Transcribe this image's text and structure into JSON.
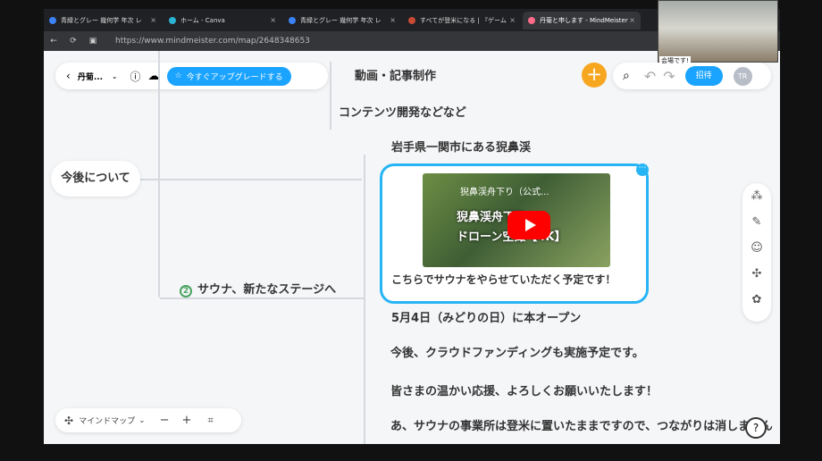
{
  "tabs": [
    {
      "label": "青緑とグレー 幾何学 年次 レ",
      "active": false
    },
    {
      "label": "ホーム - Canva",
      "active": false
    },
    {
      "label": "青緑とグレー 幾何学 年次 レ",
      "active": false
    },
    {
      "label": "すべてが登米になる | 『ゲーム",
      "active": false
    },
    {
      "label": "丹菊と申します - MindMeister",
      "active": true
    }
  ],
  "url": "https://www.mindmeister.com/map/2648348653",
  "toolbar": {
    "title": "丹菊...",
    "upgrade": "今すぐアップグレードする"
  },
  "top_actions": {
    "invite": "招待",
    "avatar": "TR"
  },
  "nodes": {
    "today": "今後について",
    "video_editing": "動画・記事制作",
    "content": "コンテンツ開発などなど",
    "iwate": "岩手県一関市にある猊鼻渓",
    "sauna": "サウナ、新たなステージへ",
    "sauna_number": "2",
    "video_caption": "こちらでサウナをやらせていただく予定です！",
    "opening": "5月4日（みどりの日）に本オープン",
    "crowdfunding": "今後、クラウドファンディングも実施予定です。",
    "support": "皆さまの温かい応援、よろしくお願いいたします！",
    "business": "あ、サウナの事業所は登米に置いたままですので、つながりは消しません"
  },
  "video": {
    "title": "猊鼻渓舟下り（公式...",
    "overlay_line1": "猊鼻渓舟下り",
    "overlay_line2": "ドローン空撮【4K】"
  },
  "bottom": {
    "label": "マインドマップ"
  },
  "webcam": {
    "label": "会場です!"
  }
}
